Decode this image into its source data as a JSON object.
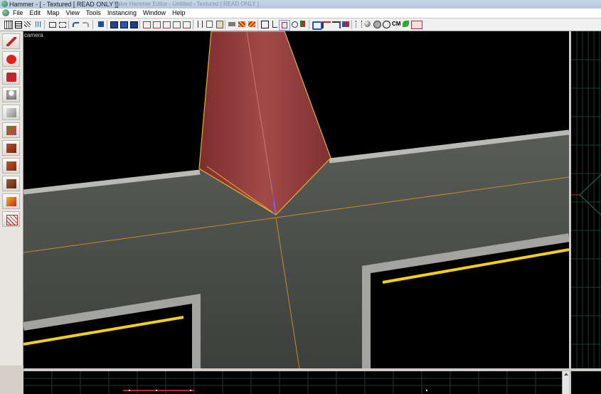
{
  "window": {
    "title": "Hammer - [ - Textured [ READ ONLY ]]",
    "ghost_text": "Valve Hammer Editor - Untitled - Textured [ READ ONLY ]"
  },
  "menu": {
    "items": [
      "File",
      "Edit",
      "Map",
      "View",
      "Tools",
      "Instancing",
      "Window",
      "Help"
    ]
  },
  "toolbar": {
    "cm_label": "CM",
    "icons": [
      "grid-icon",
      "grid-toggle-icon",
      "3d-grid-icon",
      "undo-icon",
      "redo-icon",
      "carve-icon",
      "group-icon",
      "ungroup-icon",
      "hide-icon",
      "texture-lock-icon",
      "cut-icon",
      "copy-icon",
      "paste-icon",
      "texture-icon",
      "replace-textures-icon",
      "transform-icon",
      "selection-icon",
      "entity-report-icon",
      "check-problems-icon",
      "map-properties-icon",
      "run-map-icon",
      "compile-icon"
    ]
  },
  "left_tools": [
    "selection-tool-icon",
    "magnify-tool-icon",
    "camera-tool-icon",
    "entity-tool-icon",
    "block-tool-icon",
    "texture-tool-icon",
    "apply-texture-icon",
    "decal-tool-icon",
    "overlay-tool-icon",
    "clip-tool-icon",
    "vertex-tool-icon"
  ],
  "viewport": {
    "label": "camera",
    "background": "#000000",
    "road_color": "#4a4c4a",
    "selection_color": "#c88a2a",
    "brush_color": "#8e3b3b",
    "stripe_color": "#f2cf1d"
  }
}
